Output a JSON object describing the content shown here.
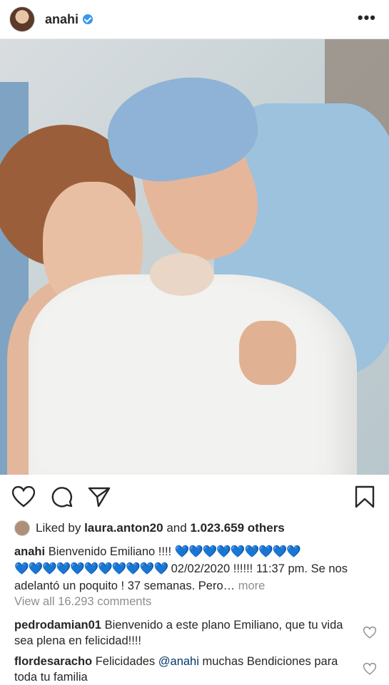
{
  "header": {
    "username": "anahi",
    "more_label": "•••",
    "icons": [
      "verified-badge-icon",
      "more-options-icon"
    ]
  },
  "actions": {
    "icons": [
      "heart-icon",
      "comment-icon",
      "share-icon",
      "bookmark-icon"
    ]
  },
  "likes": {
    "prefix": "Liked by",
    "user": "laura.anton20",
    "middle": "and",
    "count": "1.023.659 others"
  },
  "caption": {
    "user": "anahi",
    "text_start": "Bienvenido Emiliano !!!!",
    "hearts_line1": "💙💙💙💙💙💙💙💙💙",
    "hearts_line2": "💙💙💙💙💙💙💙💙💙💙💙",
    "text_mid": "02/02/2020 !!!!!! 11:37 pm. Se nos adelantó un poquito ! 37 semanas. Pero…",
    "more": "more"
  },
  "view_all": "View all 16.293 comments",
  "comments": [
    {
      "user": "pedrodamian01",
      "text": "Bienvenido a este plano Emiliano, que tu vida sea plena en felicidad!!!!"
    },
    {
      "user": "flordesaracho",
      "text_before": "Felicidades",
      "mention": "@anahi",
      "text_after": "muchas Bendiciones para toda tu familia"
    }
  ],
  "colors": {
    "accent": "#3897f0",
    "muted": "#8e8e8e",
    "heart_blue": "#1a7cf5"
  }
}
